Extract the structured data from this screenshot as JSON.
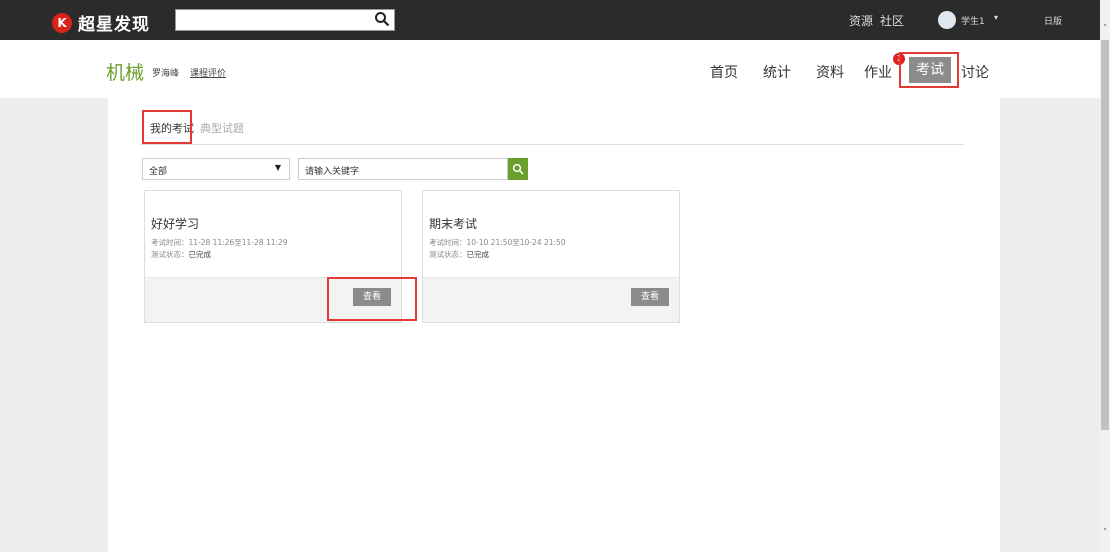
{
  "topbar": {
    "logo_text": "超星发现",
    "logo_mark": "K",
    "search_icon": "search-icon",
    "links": [
      "资源",
      "社区"
    ],
    "user_name": "学生1",
    "user_caret": "▾",
    "lang": "日版"
  },
  "course": {
    "name": "机械",
    "teacher": "罗海峰",
    "evaluation": "课程评价"
  },
  "nav": {
    "items": [
      "首页",
      "统计",
      "资料",
      "作业",
      "考试",
      "讨论"
    ],
    "active": "考试",
    "badge": "1"
  },
  "tabs": {
    "active": "我的考试",
    "inactive": "典型试题"
  },
  "filter": {
    "selected": "全部",
    "caret": "▼",
    "keyword_placeholder": "请输入关键字"
  },
  "exams": [
    {
      "title": "好好学习",
      "time": "考试时间：11-28 11:26至11-28 11:29",
      "status_label": "测试状态：",
      "status": "已完成",
      "button": "查看"
    },
    {
      "title": "期末考试",
      "time": "考试时间：10-10 21:50至10-24 21:50",
      "status_label": "测试状态：",
      "status": "已完成",
      "button": "查看"
    }
  ],
  "colors": {
    "topbar": "#2b2b2b",
    "accent_green": "#6a9e2d",
    "highlight_red": "#e53935",
    "active_nav": "#8c8c8c"
  }
}
